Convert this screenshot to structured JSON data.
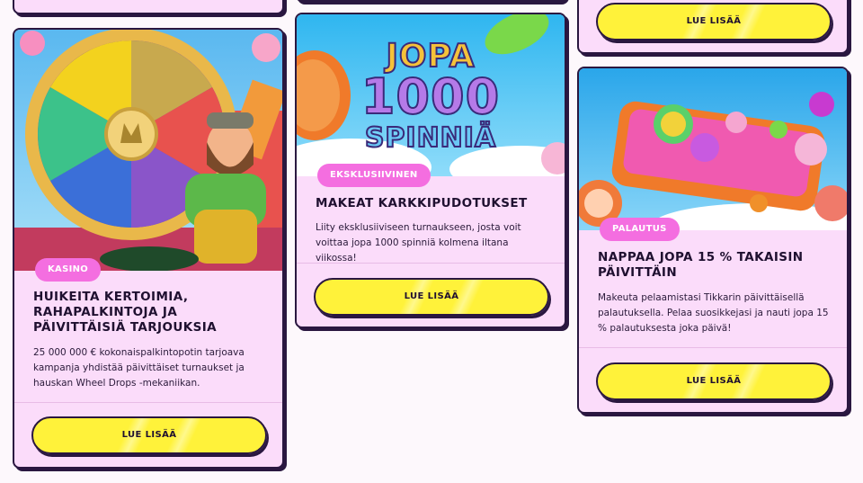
{
  "cards": [
    {
      "badge": "KASINO",
      "title": "HUIKEITA KERTOIMIA, RAHAPALKINTOJA JA PÄIVITTÄISIÄ TARJOUKSIA",
      "description": "25 000 000 € kokonaispalkintopotin tarjoava kampanja yhdistää päivittäiset turnaukset ja hauskan Wheel Drops -mekaniikan.",
      "button": "LUE LISÄÄ"
    },
    {
      "image_text_line1": "JOPA",
      "image_text_line2": "1000",
      "image_text_line3": "SPINNIÄ",
      "badge": "EKSKLUSIIVINEN",
      "title": "MAKEAT KARKKIPUDOTUKSET",
      "description": "Liity eksklusiiviseen turnaukseen, josta voit voittaa jopa 1000 spinniä kolmena iltana viikossa!",
      "button": "LUE LISÄÄ"
    },
    {
      "badge": "PALAUTUS",
      "title": "NAPPAA JOPA 15 % TAKAISIN PÄIVITTÄIN",
      "description": "Makeuta pelaamistasi Tikkarin päivittäisellä palautuksella. Pelaa suosikkejasi ja nauti jopa 15 % palautuksesta joka päivä!",
      "button": "LUE LISÄÄ"
    }
  ],
  "top_right_button": "LUE LISÄÄ",
  "colors": {
    "card_bg": "#fbdcfa",
    "badge": "#f46ee0",
    "button": "#fff23a",
    "border": "#2a1740"
  }
}
